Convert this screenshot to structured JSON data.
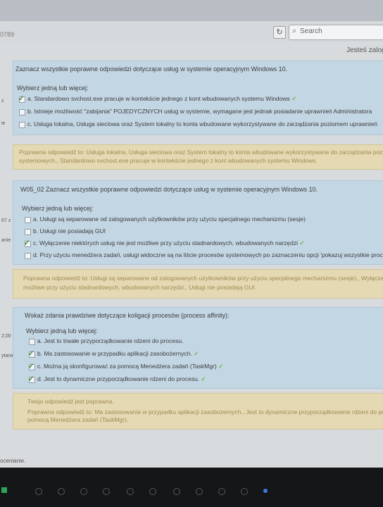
{
  "browser": {
    "url_fragment": "0789",
    "search_placeholder": "Search"
  },
  "header": {
    "logged_in_text": "Jesteś zalogo"
  },
  "q1": {
    "side_mark": "z",
    "side_mark_2": "ie",
    "prompt": "Zaznacz wszystkie poprawne odpowiedzi dotyczące usług w systemie operacyjnym Windows 10.",
    "instruction": "Wybierz jedną lub więcej:",
    "options": [
      {
        "label": "a. Standardowo svchost.exe pracuje w kontekście jednego z kont wbudowanych systemu Windows",
        "checked": true,
        "correct": true
      },
      {
        "label": "b. Istnieje możliwość \"zabijania\" POJEDYCZNYCH usług w systemie, wymagane jest jednak posiadanie uprawnień Administratora",
        "checked": false,
        "correct": false
      },
      {
        "label": "c. Usługa lokalna, Usługa sieciowa oraz System lokalny to konta wbudowane wykorzystywane do zarządzania poziomem uprawnień",
        "checked": false,
        "correct": false
      }
    ],
    "feedback_lines": [
      "Poprawna odpowiedź to: Usługa lokalna, Usługa sieciowa oraz System lokalny to konta wbudowane wykorzystywane do zarządzania poz",
      "systemowych., Standardowo svchost.exe pracuje w kontekście jednego z kont wbudowanych systemu Windows."
    ]
  },
  "q2": {
    "side_mark": "67 z",
    "side_mark_2": "anie",
    "prompt": "W05_02 Zaznacz wszystkie poprawne odpowiedzi dotyczące usług w systemie operacyjnym Windows 10.",
    "instruction": "Wybierz jedną lub więcej:",
    "options": [
      {
        "label": "a. Usługi są separowane od zalogowanych użytkowników przy użyciu specjalnego mechanizmu (sesje)",
        "checked": false,
        "correct": false
      },
      {
        "label": "b. Usługi nie posiadają GUI",
        "checked": false,
        "correct": false
      },
      {
        "label": "c. Wyłączenie niektórych usług nie jest możliwe przy użyciu stadnardowych, wbudowanych narzędzi",
        "checked": true,
        "correct": true
      },
      {
        "label": "d. Przy użyciu menedżera zadań, usługi widoczne są na liście procesów systemowych po zaznaczeniu opcji 'pokazuj wszystkie proces",
        "checked": false,
        "correct": false
      }
    ],
    "feedback_lines": [
      "Poprawna odpowiedź to: Usługi są separowane od zalogowanych użytkowników przy użyciu specjalnego mechanizmu (sesje)., Wyłączenie",
      "możliwe przy użyciu stadnardowych, wbudowanych narzędzi., Usługi nie posiadają GUI."
    ]
  },
  "q3": {
    "side_mark": "2,00 z",
    "side_mark_2": "ytanie",
    "prompt": "Wskaż zdania prawdziwe dotyczące koligacji procesów (process affinity):",
    "instruction": "Wybierz jedną lub więcej:",
    "options": [
      {
        "label": "a. Jest to trwałe przyporządkowanie rdzeni do procesu.",
        "checked": false,
        "correct": false
      },
      {
        "label": "b. Ma zastosowanie w przypadku aplikacji zasobożernych.",
        "checked": true,
        "correct": true
      },
      {
        "label": "c. Można ją skonfigurować za pomocą Menedżera zadań (TaskMgr)",
        "checked": true,
        "correct": true
      },
      {
        "label": "d. Jest to dynamiczne przyporządkowanie rdzeni do procesu.",
        "checked": true,
        "correct": true
      }
    ],
    "feedback_lines": [
      "Twoja odpowiedź jest poprawna.",
      "Poprawna odpowiedź to: Ma zastosowanie w przypadku aplikacji zasobożernych., Jest to dynamiczne przyporządkowanie rdzeni do proces",
      "pomocą Menedżera zadań (TaskMgr)."
    ]
  },
  "footer": {
    "status_text": "ocenianie."
  },
  "colors": {
    "question_bg": "#c3d6e4",
    "feedback_bg": "#e5d9b4",
    "correct_tick": "#6fb43c"
  }
}
